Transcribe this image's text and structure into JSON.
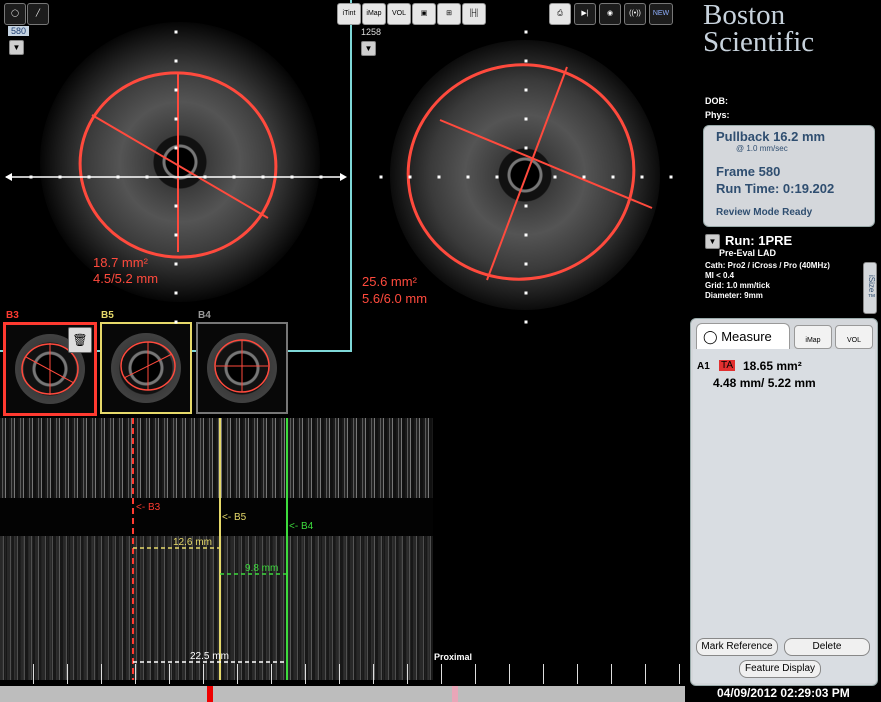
{
  "viewer": {
    "left_frame_number": "580",
    "right_frame_number": "1258",
    "left_area": "18.7 mm²",
    "left_diameters": "4.5/5.2 mm",
    "right_area": "25.6 mm²",
    "right_diameters": "5.6/6.0 mm"
  },
  "toolbar": {
    "buttons": [
      {
        "icon": "lasso-tool-icon",
        "label": ""
      },
      {
        "icon": "pen-tool-icon",
        "label": ""
      },
      {
        "icon": "itint-icon",
        "label": "iTint"
      },
      {
        "icon": "imap-icon",
        "label": "iMap"
      },
      {
        "icon": "vol-icon",
        "label": "VOL"
      },
      {
        "icon": "layers-icon",
        "label": ""
      },
      {
        "icon": "grid-icon",
        "label": ""
      },
      {
        "icon": "longitudinal-icon",
        "label": ""
      },
      {
        "icon": "print-icon",
        "label": ""
      },
      {
        "icon": "play-icon",
        "label": ""
      },
      {
        "icon": "record-icon",
        "label": ""
      },
      {
        "icon": "broadcast-icon",
        "label": ""
      },
      {
        "icon": "new-icon",
        "label": "NEW"
      }
    ]
  },
  "brand": {
    "line1": "Boston",
    "line2": "Scientific"
  },
  "patient": {
    "dob_label": "DOB:",
    "phys_label": "Phys:"
  },
  "pullback": {
    "title": "Pullback 16.2 mm",
    "speed": "@ 1.0 mm/sec",
    "frame": "Frame 580",
    "run_time": "Run Time: 0:19.202",
    "status": "Review Mode Ready"
  },
  "run": {
    "name": "Run: 1PRE",
    "subtitle": "Pre-Eval LAD",
    "cath": "Cath: Pro2 / iCross / Pro (40MHz)",
    "mi": "MI <  0.4",
    "grid": "Grid:    1.0 mm/tick",
    "diameter": "Diameter:   9mm",
    "isize_tag": "iSize™"
  },
  "measure": {
    "tab_measure": "Measure",
    "tab_imap": "iMap",
    "tab_vol": "VOL",
    "id": "A1",
    "type_badge": "TA",
    "area": "18.65 mm²",
    "diameters": "4.48 mm/ 5.22 mm",
    "btn_mark_reference": "Mark Reference",
    "btn_delete": "Delete",
    "btn_feature_display": "Feature Display"
  },
  "bookmarks": [
    {
      "label": "B3",
      "color": "#ff3a30"
    },
    {
      "label": "B5",
      "color": "#e6d96a"
    },
    {
      "label": "B4",
      "color": "#9a9a9a"
    }
  ],
  "longitudinal": {
    "marker_b3": "<- B3",
    "marker_b5": "<- B5",
    "marker_b4": "<- B4",
    "dist_1": "12.6 mm",
    "dist_2": "9.8 mm",
    "dist_3": "22.5 mm",
    "proximal": "Proximal"
  },
  "datetime": "04/09/2012 02:29:03 PM",
  "colors": {
    "measure_red": "#ff4a3d",
    "b5_yellow": "#e6d96a",
    "b4_green": "#3ddc3d",
    "frame_cyan": "#7fd8d8",
    "panel_text": "#2f4e70"
  }
}
